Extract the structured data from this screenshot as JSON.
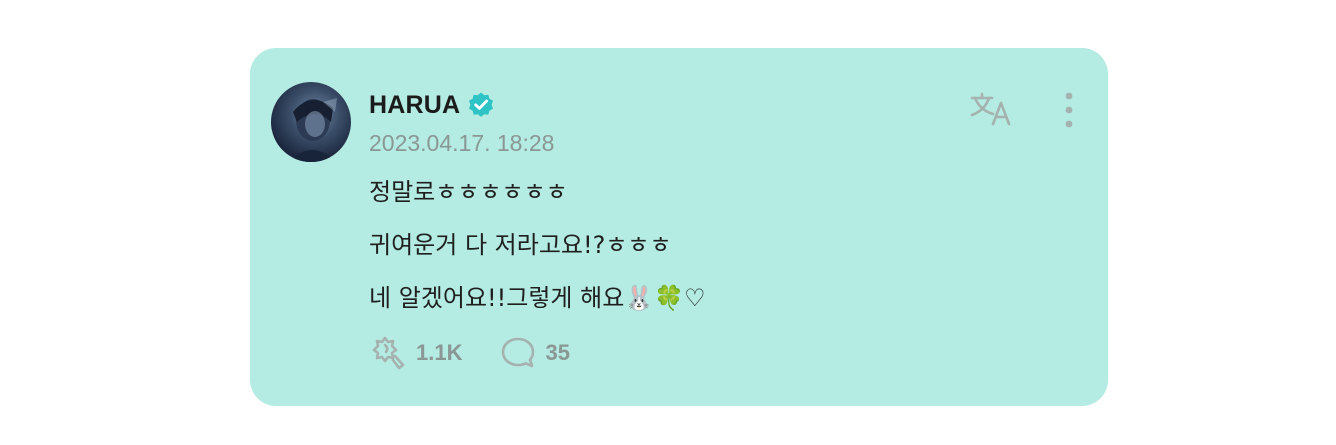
{
  "post": {
    "author": {
      "name": "HARUA",
      "verified": true,
      "avatar_icon": "avatar-photo"
    },
    "timestamp": "2023.04.17. 18:28",
    "lines": [
      "정말로ㅎㅎㅎㅎㅎㅎ",
      "귀여운거 다 저라고요!?ㅎㅎㅎ",
      "네 알겠어요!!그렇게 해요🐰🍀♡"
    ],
    "actions": {
      "likes_count": "1.1K",
      "comments_count": "35"
    },
    "icons": {
      "verified": "verified-badge-icon",
      "translate": "translate-icon",
      "more": "more-vertical-icon",
      "like": "like-icon",
      "comment": "comment-icon"
    }
  },
  "colors": {
    "card_background": "#b4ebe2",
    "verified_badge": "#2ec4c6",
    "muted_text": "#8a9794",
    "icon_gray": "#a5b2af"
  }
}
